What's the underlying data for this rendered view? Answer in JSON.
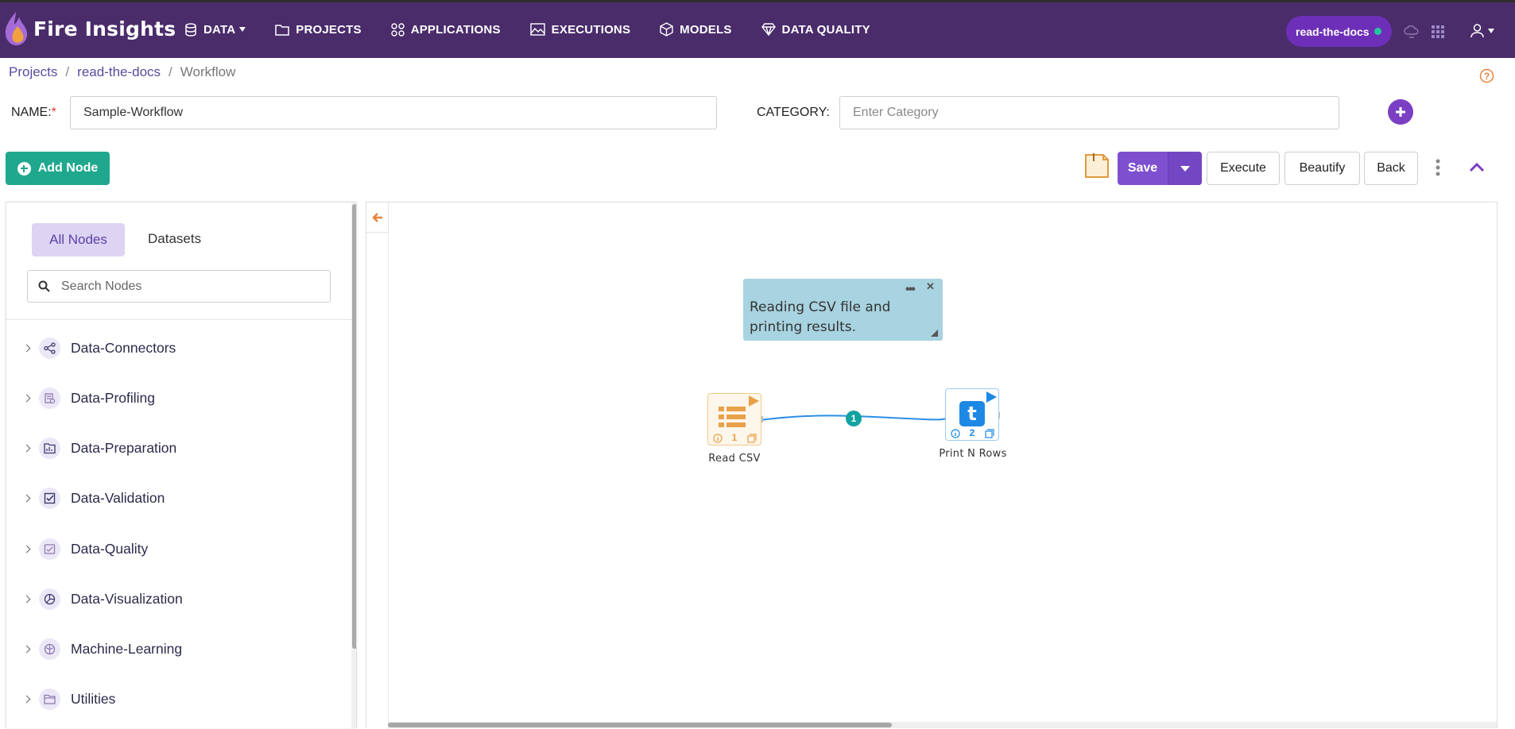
{
  "app": {
    "brand": "Fire Insights"
  },
  "nav": [
    {
      "label": "DATA",
      "icon": "database-icon",
      "dropdown": true
    },
    {
      "label": "PROJECTS",
      "icon": "folder-icon"
    },
    {
      "label": "APPLICATIONS",
      "icon": "apps-grid-icon"
    },
    {
      "label": "EXECUTIONS",
      "icon": "image-icon"
    },
    {
      "label": "MODELS",
      "icon": "cube-icon"
    },
    {
      "label": "DATA QUALITY",
      "icon": "diamond-icon"
    }
  ],
  "topbar": {
    "project_pill": "read-the-docs",
    "status_color": "#23c7a0"
  },
  "breadcrumb": {
    "projects": "Projects",
    "project": "read-the-docs",
    "current": "Workflow",
    "sep": "/"
  },
  "form": {
    "name_label": "NAME:",
    "required_mark": "*",
    "name_value": "Sample-Workflow",
    "category_label": "CATEGORY:",
    "category_placeholder": "Enter Category"
  },
  "toolbar": {
    "add_node": "Add Node",
    "save": "Save",
    "execute": "Execute",
    "beautify": "Beautify",
    "back": "Back"
  },
  "panel": {
    "tabs": [
      "All Nodes",
      "Datasets"
    ],
    "search_placeholder": "Search Nodes",
    "categories": [
      {
        "label": "Data-Connectors",
        "icon": "share-icon"
      },
      {
        "label": "Data-Profiling",
        "icon": "profile-icon"
      },
      {
        "label": "Data-Preparation",
        "icon": "folder-chart-icon"
      },
      {
        "label": "Data-Validation",
        "icon": "checkbox-icon"
      },
      {
        "label": "Data-Quality",
        "icon": "quality-icon"
      },
      {
        "label": "Data-Visualization",
        "icon": "pie-chart-icon"
      },
      {
        "label": "Machine-Learning",
        "icon": "brain-icon"
      },
      {
        "label": "Utilities",
        "icon": "folder-icon"
      }
    ]
  },
  "canvas": {
    "sticky_note": "Reading CSV file and printing results.",
    "nodes": [
      {
        "label": "Read CSV",
        "count": "1",
        "color": "#e8a14a"
      },
      {
        "label": "Print N Rows",
        "count": "2",
        "color": "#1e88e5"
      }
    ],
    "edge_label": "1"
  },
  "colors": {
    "topbar": "#4a2c6b",
    "accent": "#7e4fcf",
    "add_node": "#1fa88d"
  }
}
